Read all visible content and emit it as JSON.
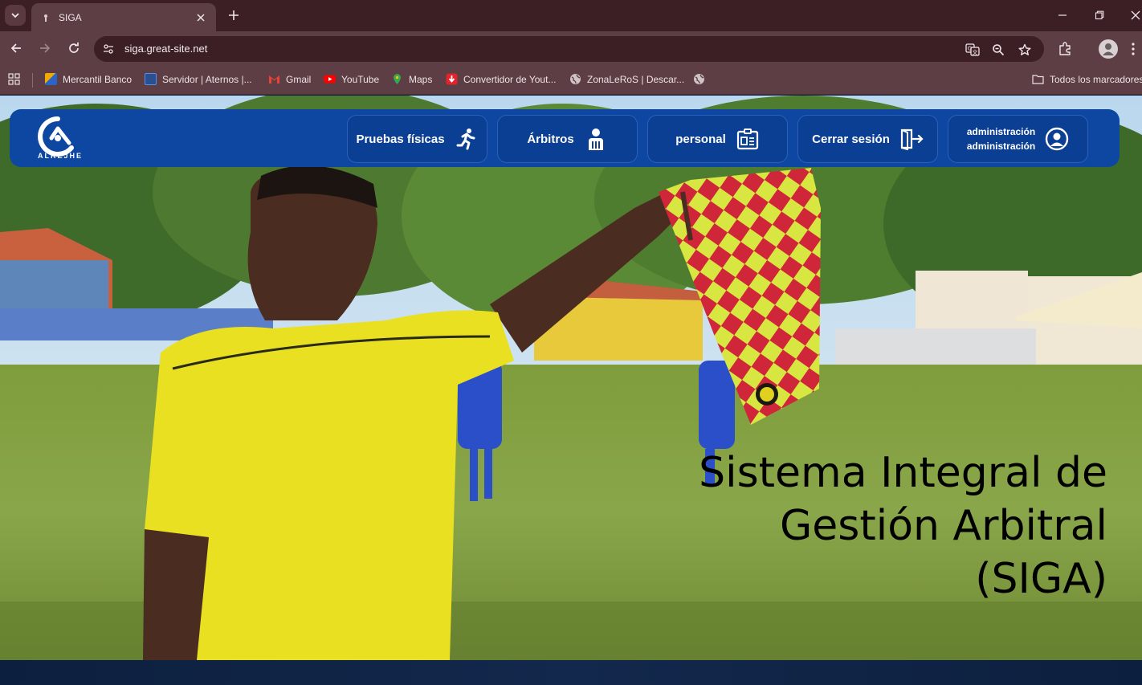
{
  "browser": {
    "tab_title": "SIGA",
    "url": "siga.great-site.net",
    "bookmarks": [
      {
        "label": "Mercantil Banco",
        "icon": "mercantil-icon",
        "color": "#2b63c7"
      },
      {
        "label": "Servidor | Aternos |...",
        "icon": "aternos-icon",
        "color": "#3c7be0"
      },
      {
        "label": "Gmail",
        "icon": "gmail-icon",
        "color": "#ea4335"
      },
      {
        "label": "YouTube",
        "icon": "youtube-icon",
        "color": "#ff0000"
      },
      {
        "label": "Maps",
        "icon": "maps-icon",
        "color": "#34a853"
      },
      {
        "label": "Convertidor de Yout...",
        "icon": "converter-icon",
        "color": "#e3222b"
      },
      {
        "label": "ZonaLeRoS | Descar...",
        "icon": "globe-icon",
        "color": "#cfc3c5"
      }
    ],
    "all_bookmarks": "Todos los marcadores"
  },
  "site": {
    "logo_text": "ALREJHE",
    "nav": [
      {
        "label": "Pruebas físicas",
        "icon": "running-person-icon"
      },
      {
        "label": "Árbitros",
        "icon": "referee-icon"
      },
      {
        "label": "personal",
        "icon": "id-card-icon"
      },
      {
        "label": "Cerrar sesión",
        "icon": "logout-icon"
      }
    ],
    "user": {
      "line1": "administración",
      "line2": "administración",
      "icon": "user-circle-icon"
    },
    "hero_title_1": "Sistema Integral de",
    "hero_title_2": "Gestión Arbitral",
    "hero_title_3": "(SIGA)"
  },
  "colors": {
    "navbar": "#0d47a1",
    "chrome": "#5c3e44",
    "tabstrip": "#3b1f25"
  }
}
